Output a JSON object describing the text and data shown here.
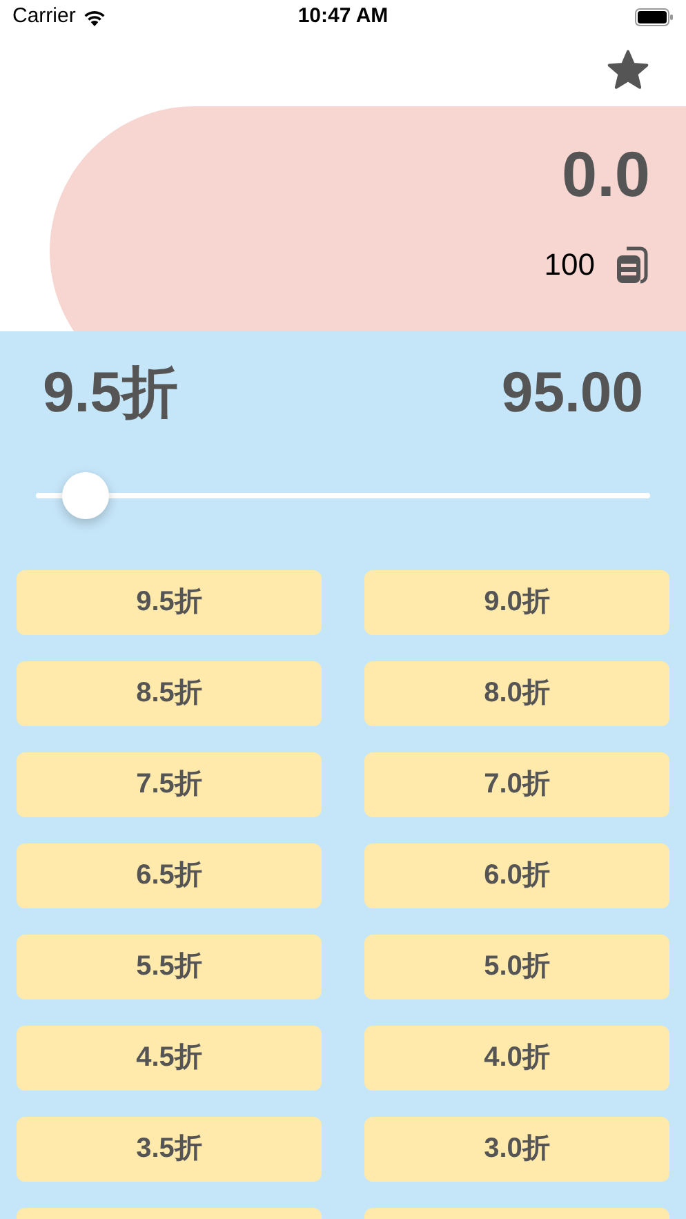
{
  "status_bar": {
    "carrier": "Carrier",
    "time": "10:47 AM"
  },
  "summary": {
    "amount": "0.0",
    "price": "100"
  },
  "discount": {
    "label": "9.5折",
    "result": "95.00",
    "slider": {
      "level": 0.08
    }
  },
  "buttons": [
    {
      "kind": "labeled",
      "label": "9.5折"
    },
    {
      "kind": "labeled",
      "label": "9.0折"
    },
    {
      "kind": "labeled",
      "label": "8.5折"
    },
    {
      "kind": "labeled",
      "label": "8.0折"
    },
    {
      "kind": "labeled",
      "label": "7.5折"
    },
    {
      "kind": "labeled",
      "label": "7.0折"
    },
    {
      "kind": "labeled",
      "label": "6.5折"
    },
    {
      "kind": "labeled",
      "label": "6.0折"
    },
    {
      "kind": "labeled",
      "label": "5.5折"
    },
    {
      "kind": "labeled",
      "label": "5.0折"
    },
    {
      "kind": "labeled",
      "label": "4.5折"
    },
    {
      "kind": "labeled",
      "label": "4.0折"
    },
    {
      "kind": "labeled",
      "label": "3.5折"
    },
    {
      "kind": "labeled",
      "label": "3.0折"
    },
    {
      "kind": "cut_off"
    },
    {
      "kind": "cut_off"
    }
  ]
}
